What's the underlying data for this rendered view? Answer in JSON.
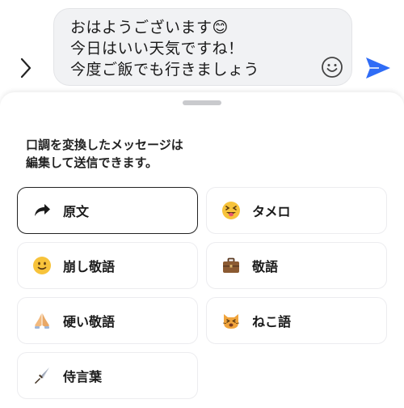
{
  "composer": {
    "message_lines": [
      "おはようございます😊",
      "今日はいい天気ですね！",
      "今度ご飯でも行きましょう"
    ],
    "icons": {
      "expand": "chevron-right-icon",
      "emoji": "smiley-face-icon",
      "send": "paper-plane-send-icon"
    },
    "accent_color": "#2f6cf6"
  },
  "sheet": {
    "info_lines": [
      "口調を変換したメッセージは",
      "編集して送信できます。"
    ],
    "options": [
      {
        "label": "原文",
        "icon": "share-arrow-icon",
        "selected": true
      },
      {
        "label": "タメロ",
        "icon": "tongue-out-face-icon",
        "selected": false
      },
      {
        "label": "崩し敬語",
        "icon": "slightly-smiling-face-icon",
        "selected": false
      },
      {
        "label": "敬語",
        "icon": "briefcase-icon",
        "selected": false
      },
      {
        "label": "硬い敬語",
        "icon": "folded-hands-icon",
        "selected": false
      },
      {
        "label": "ねこ語",
        "icon": "cat-face-icon",
        "selected": false
      },
      {
        "label": "侍言葉",
        "icon": "dagger-icon",
        "selected": false
      }
    ]
  }
}
